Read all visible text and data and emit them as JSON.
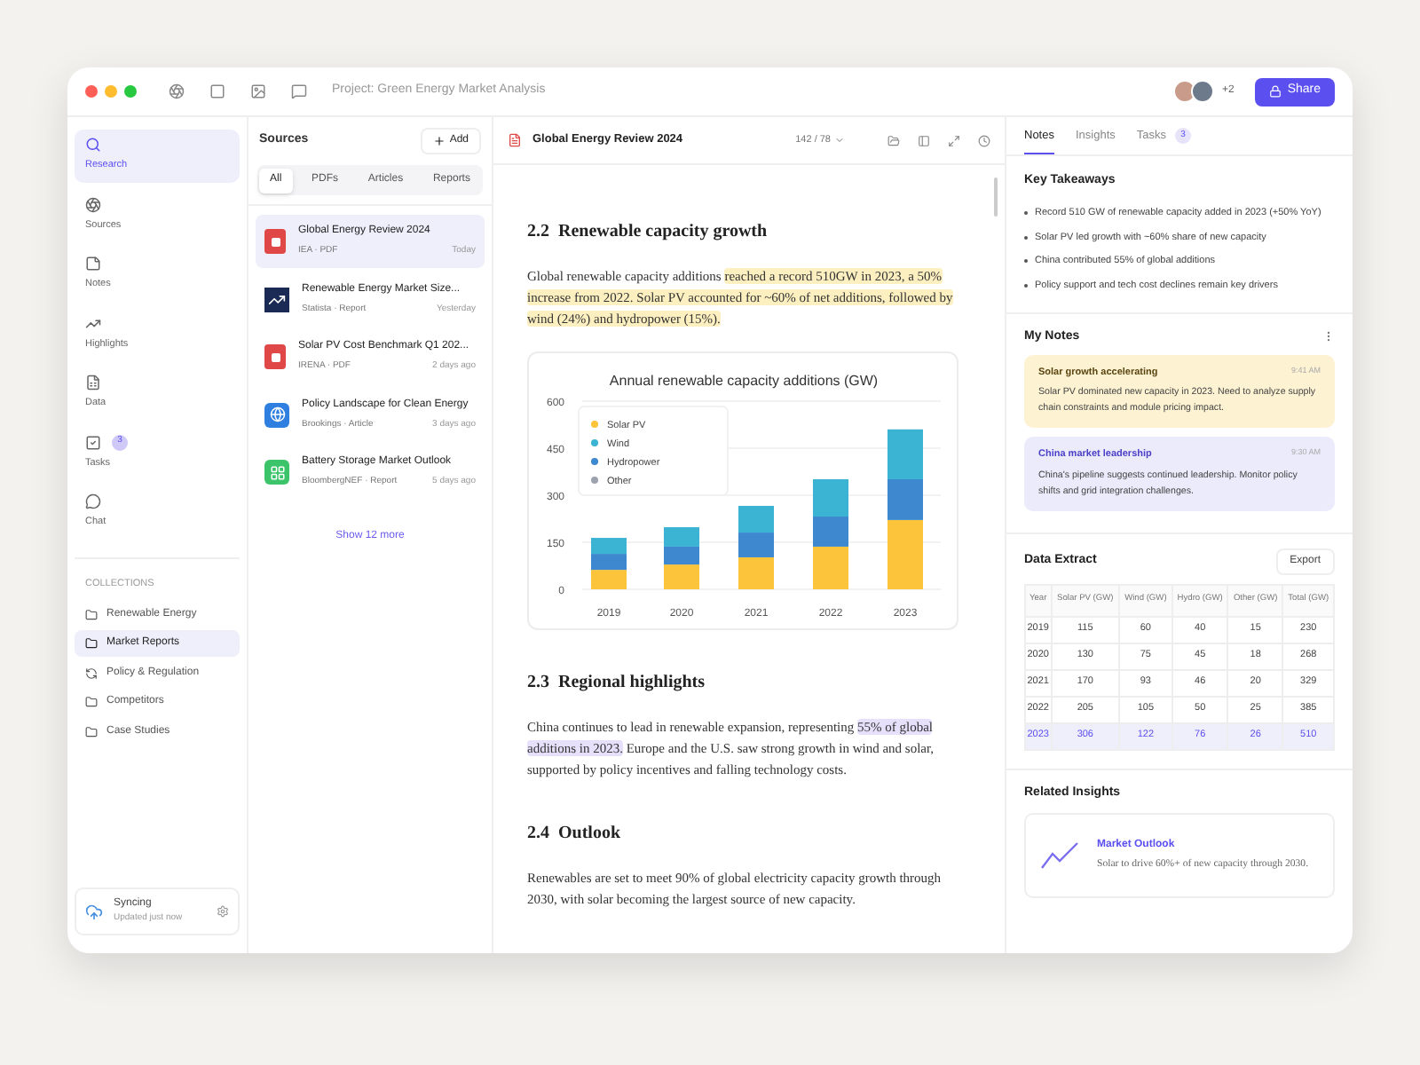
{
  "window": {
    "title": "Project: Green Energy Market Analysis",
    "collaborators_more": "+2",
    "share": "Share"
  },
  "nav": [
    {
      "label": "Research",
      "kind": "search",
      "selected": true
    },
    {
      "label": "Sources",
      "kind": "sources",
      "selected": false
    },
    {
      "label": "Notes",
      "kind": "notes",
      "selected": false
    },
    {
      "label": "Highlights",
      "kind": "highlights",
      "selected": false
    },
    {
      "label": "Data",
      "kind": "data",
      "selected": false
    },
    {
      "label": "Tasks",
      "kind": "tasks",
      "selected": false,
      "badge": "3"
    },
    {
      "label": "Chat",
      "kind": "chat",
      "selected": false
    }
  ],
  "collections": {
    "heading": "COLLECTIONS",
    "items": [
      {
        "label": "Renewable Energy",
        "kind": "folder",
        "selected": false
      },
      {
        "label": "Market Reports",
        "kind": "folder",
        "selected": true
      },
      {
        "label": "Policy & Regulation",
        "kind": "refresh",
        "selected": false
      },
      {
        "label": "Competitors",
        "kind": "folder",
        "selected": false
      },
      {
        "label": "Case Studies",
        "kind": "folder",
        "selected": false
      }
    ]
  },
  "sync": {
    "title": "Syncing",
    "subtitle": "Updated just now"
  },
  "sources": {
    "title": "Sources",
    "add": "Add",
    "filters": [
      {
        "label": "All",
        "selected": true
      },
      {
        "label": "PDFs",
        "selected": false
      },
      {
        "label": "Articles",
        "selected": false
      },
      {
        "label": "Reports",
        "selected": false
      }
    ],
    "items": [
      {
        "title": "Global Energy Review 2024",
        "meta": "IEA · PDF",
        "time": "Today",
        "kind": "pdf",
        "selected": true
      },
      {
        "title": "Renewable Energy Market Size...",
        "meta": "Statista · Report",
        "time": "Yesterday",
        "kind": "chart",
        "selected": false
      },
      {
        "title": "Solar PV Cost Benchmark Q1 202...",
        "meta": "IRENA · PDF",
        "time": "2 days ago",
        "kind": "pdf",
        "selected": false
      },
      {
        "title": "Policy Landscape for Clean Energy",
        "meta": "Brookings · Article",
        "time": "3 days ago",
        "kind": "web",
        "selected": false
      },
      {
        "title": "Battery Storage Market Outlook",
        "meta": "BloombergNEF · Report",
        "time": "5 days ago",
        "kind": "grid",
        "selected": false
      }
    ],
    "show_more": "Show 12 more"
  },
  "document": {
    "title": "Global Energy Review 2024",
    "page": "142 / 78",
    "sections": [
      {
        "heading": "2.2  Renewable capacity growth",
        "paragraph": [
          {
            "text": "Global renewable capacity additions"
          },
          {
            "text": "reached a record 510GW in 2023, a 50%",
            "color": "#fcefc0"
          },
          {
            "text": "increase from 2022. Solar PV accounted for ~60% of net additions, followed by",
            "color": "#fcefc0"
          },
          {
            "text": "wind (24%) and hydropower (15%).",
            "color": "#fcefc0"
          }
        ],
        "chart_data": {
          "type": "bar",
          "title": "Annual renewable capacity additions (GW)",
          "categories": [
            "2019",
            "2020",
            "2021",
            "2022",
            "2023"
          ],
          "stacked": true,
          "grid": true,
          "legend": true,
          "ylim": [
            0,
            600
          ],
          "yticks": [
            0,
            150,
            300,
            450,
            600
          ],
          "series": [
            {
              "name": "Solar PV",
              "color": "#fcc43a",
              "values": [
                62,
                79,
                102,
                136,
                221
              ]
            },
            {
              "name": "Wind",
              "color": "#3bb3d3",
              "values": [
                51,
                62,
                85,
                119,
                159
              ]
            },
            {
              "name": "Hydropower",
              "color": "#3d88cf",
              "values": [
                51,
                57,
                79,
                96,
                130
              ]
            },
            {
              "name": "Other",
              "color": "#9ca3af",
              "values": [
                0,
                0,
                0,
                0,
                0
              ]
            }
          ]
        }
      },
      {
        "heading": "2.3  Regional highlights",
        "paragraph": [
          {
            "text": "China continues to lead in renewable expansion, representing"
          },
          {
            "text": "55% of global",
            "color": "#e6e0fb"
          },
          {
            "text": "additions in 2023.",
            "color": "#e6e0fb"
          },
          {
            "text": "Europe and the U.S. saw strong growth in wind and solar, supported by policy incentives and falling technology costs."
          }
        ]
      },
      {
        "heading": "2.4  Outlook",
        "paragraph": [
          {
            "text": "Renewables are set to meet 90% of global electricity capacity growth through 2030, with solar becoming the largest source of new capacity."
          }
        ]
      }
    ]
  },
  "panel": {
    "tabs": [
      {
        "label": "Notes",
        "selected": true
      },
      {
        "label": "Insights",
        "selected": false
      },
      {
        "label": "Tasks",
        "selected": false,
        "badge": "3"
      }
    ],
    "takeaways": {
      "title": "Key Takeaways",
      "items": [
        "Record 510 GW of renewable capacity added in 2023 (+50% YoY)",
        "Solar PV led growth with ~60% share of new capacity",
        "China contributed 55% of global additions",
        "Policy support and tech cost declines remain key drivers"
      ]
    },
    "notes": {
      "title": "My Notes",
      "items": [
        {
          "title": "Solar growth accelerating",
          "time": "9:41 AM",
          "body": "Solar PV dominated new capacity in 2023. Need to analyze supply chain constraints and module pricing impact.",
          "color": "#fdf3d3"
        },
        {
          "title": "China market leadership",
          "time": "9:30 AM",
          "body": "China's pipeline suggests continued leadership. Monitor policy shifts and grid integration challenges.",
          "color": "#ecebfb"
        }
      ]
    },
    "extract": {
      "title": "Data Extract",
      "export": "Export",
      "columns": [
        "Year",
        "Solar PV (GW)",
        "Wind (GW)",
        "Hydro (GW)",
        "Other (GW)",
        "Total (GW)"
      ],
      "rows": [
        {
          "cells": [
            "2019",
            "115",
            "60",
            "40",
            "15",
            "230"
          ],
          "selected": false
        },
        {
          "cells": [
            "2020",
            "130",
            "75",
            "45",
            "18",
            "268"
          ],
          "selected": false
        },
        {
          "cells": [
            "2021",
            "170",
            "93",
            "46",
            "20",
            "329"
          ],
          "selected": false
        },
        {
          "cells": [
            "2022",
            "205",
            "105",
            "50",
            "25",
            "385"
          ],
          "selected": false
        },
        {
          "cells": [
            "2023",
            "306",
            "122",
            "76",
            "26",
            "510"
          ],
          "selected": true
        }
      ]
    },
    "related": {
      "title": "Related Insights",
      "cards": [
        {
          "title": "Market Outlook",
          "body": "Solar to drive 60%+ of new capacity through 2030."
        }
      ]
    }
  }
}
